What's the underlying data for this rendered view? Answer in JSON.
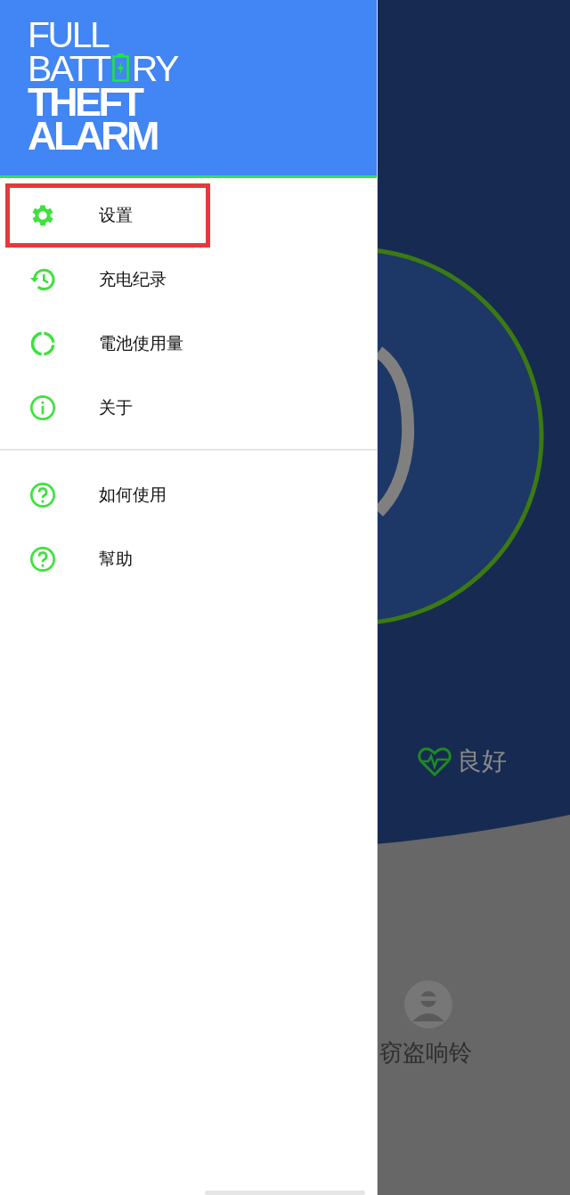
{
  "logo": {
    "line1": "FULL",
    "line2_start": "BATT",
    "line2_end": "RY",
    "line3": "THEFT",
    "line4": "ALARM"
  },
  "menu_sections": [
    [
      {
        "kind": "settings",
        "label": "设置",
        "highlighted": true
      },
      {
        "kind": "history",
        "label": "充电纪录",
        "highlighted": false
      },
      {
        "kind": "usage",
        "label": "電池使用量",
        "highlighted": false
      },
      {
        "kind": "info",
        "label": "关于",
        "highlighted": false
      }
    ],
    [
      {
        "kind": "help",
        "label": "如何使用",
        "highlighted": false
      },
      {
        "kind": "help",
        "label": "幫助",
        "highlighted": false
      }
    ]
  ],
  "background": {
    "health_status": "良好",
    "alarm_label": "窃盗响铃"
  }
}
